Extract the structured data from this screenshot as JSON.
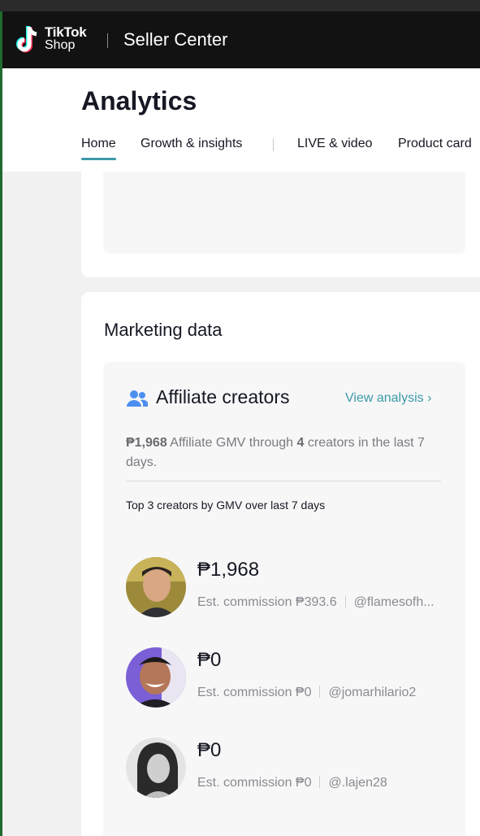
{
  "brand": {
    "line1": "TikTok",
    "line2": "Shop",
    "product": "Seller Center"
  },
  "page": {
    "title": "Analytics"
  },
  "tabs": [
    {
      "label": "Home",
      "active": true
    },
    {
      "label": "Growth & insights",
      "active": false
    },
    {
      "label": "LIVE & video",
      "active": false
    },
    {
      "label": "Product card",
      "active": false
    }
  ],
  "marketing": {
    "title": "Marketing data",
    "affiliate": {
      "title": "Affiliate creators",
      "view_link": "View analysis ›",
      "summary_amount": "₱1,968",
      "summary_mid": "Affiliate GMV through",
      "summary_count": "4",
      "summary_tail": "creators in the last 7 days.",
      "top_label": "Top 3 creators by GMV over last 7 days",
      "creators": [
        {
          "gmv": "₱1,968",
          "commission": "Est. commission ₱393.6",
          "handle": "@flamesofh..."
        },
        {
          "gmv": "₱0",
          "commission": "Est. commission ₱0",
          "handle": "@jomarhilario2"
        },
        {
          "gmv": "₱0",
          "commission": "Est. commission ₱0",
          "handle": "@.lajen28"
        }
      ]
    }
  },
  "colors": {
    "accent": "#3b9aa8",
    "topbar": "#121212",
    "panel": "#f7f7f8"
  }
}
